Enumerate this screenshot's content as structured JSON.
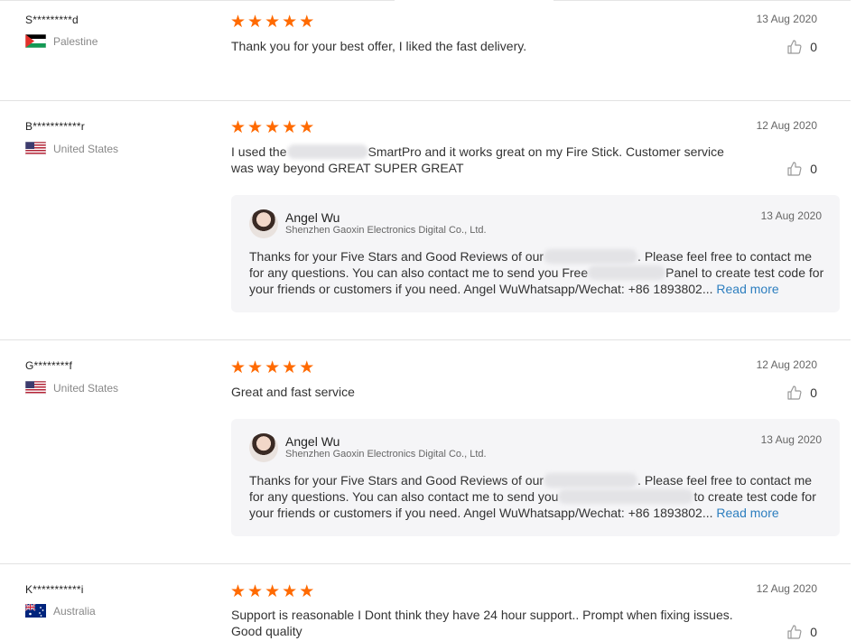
{
  "reviews": [
    {
      "user": "S*********d",
      "country": "Palestine",
      "flag": "palestine",
      "rating": 5,
      "date": "13 Aug 2020",
      "text": "Thank you for your best offer, I liked the fast delivery.",
      "helpful_count": "0"
    },
    {
      "user": "B***********r",
      "country": "United States",
      "flag": "usa",
      "rating": 5,
      "date": "12 Aug 2020",
      "text_before": "I used the",
      "text_after": "SmartPro and it works great on my Fire Stick. Customer service was way beyond GREAT   SUPER GREAT",
      "helpful_count": "0",
      "reply": {
        "seller_name": "Angel Wu",
        "company": "Shenzhen Gaoxin Electronics Digital Co., Ltd.",
        "date": "13 Aug 2020",
        "part1": "Thanks for your Five Stars and Good Reviews of our",
        "part2": ". Please feel free to contact me for any questions. You can also contact me to send you Free",
        "part3": "Panel to create test code for your friends or customers if you need. Angel WuWhatsapp/Wechat: +86 1893802...",
        "read_more": "Read more"
      }
    },
    {
      "user": "G********f",
      "country": "United States",
      "flag": "usa",
      "rating": 5,
      "date": "12 Aug 2020",
      "text": "Great and fast service",
      "helpful_count": "0",
      "reply": {
        "seller_name": "Angel Wu",
        "company": "Shenzhen Gaoxin Electronics Digital Co., Ltd.",
        "date": "13 Aug 2020",
        "part1": "Thanks for your Five Stars and Good Reviews of our",
        "part2": ". Please feel free to contact me for any questions. You can also contact me to send you",
        "part3": "to create test code for your friends or customers if you need. Angel WuWhatsapp/Wechat: +86 1893802...",
        "read_more": "Read more"
      }
    },
    {
      "user": "K***********i",
      "country": "Australia",
      "flag": "australia",
      "rating": 5,
      "date": "12 Aug 2020",
      "text": "Support is reasonable I Dont think they have 24 hour support.. Prompt when fixing issues. Good quality",
      "helpful_count": "0"
    }
  ],
  "colors": {
    "star": "#ff6a00",
    "link": "#2d7ebf",
    "reply_bg": "#f5f5f7"
  },
  "icons": {
    "rating": "star-icon",
    "helpful": "thumbs-up-icon"
  }
}
